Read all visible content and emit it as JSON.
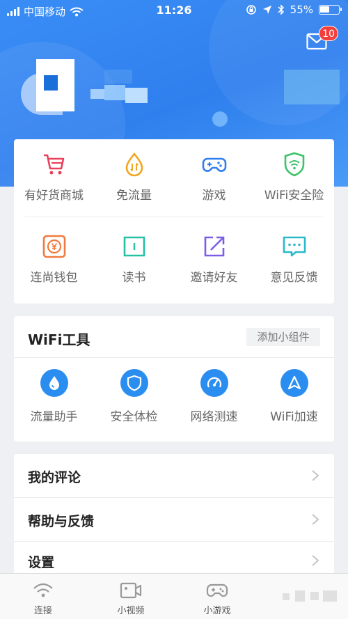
{
  "status_bar": {
    "carrier": "中国移动",
    "time": "11:26",
    "battery": "55%",
    "battery_level": 0.55
  },
  "header": {
    "mail_icon": "mail-icon",
    "unread_count": "10"
  },
  "grid": {
    "row1": [
      {
        "label": "有好货商城",
        "icon": "cart-icon",
        "color": "#e8415a"
      },
      {
        "label": "免流量",
        "icon": "free-data-icon",
        "color": "#f2a51e"
      },
      {
        "label": "游戏",
        "icon": "gamepad-icon",
        "color": "#2f7fee"
      },
      {
        "label": "WiFi安全险",
        "icon": "wifi-shield-icon",
        "color": "#3cc36a"
      }
    ],
    "row2": [
      {
        "label": "连尚钱包",
        "icon": "wallet-icon",
        "color": "#f07b3f"
      },
      {
        "label": "读书",
        "icon": "book-icon",
        "color": "#26c0a6"
      },
      {
        "label": "邀请好友",
        "icon": "invite-icon",
        "color": "#7d5ce8"
      },
      {
        "label": "意见反馈",
        "icon": "feedback-icon",
        "color": "#2bb9c9"
      }
    ]
  },
  "tools": {
    "title": "WiFi工具",
    "add_label": "添加小组件",
    "items": [
      {
        "label": "流量助手",
        "icon": "drop-icon"
      },
      {
        "label": "安全体检",
        "icon": "shield-icon"
      },
      {
        "label": "网络测速",
        "icon": "speedometer-icon"
      },
      {
        "label": "WiFi加速",
        "icon": "navigation-arrow-icon"
      }
    ],
    "accent": "#2a8df0"
  },
  "menu": {
    "items": [
      {
        "label": "我的评论"
      },
      {
        "label": "帮助与反馈"
      },
      {
        "label": "设置"
      }
    ]
  },
  "tab_bar": {
    "tabs": [
      {
        "label": "连接",
        "icon": "wifi-icon"
      },
      {
        "label": "小视频",
        "icon": "video-icon"
      },
      {
        "label": "小游戏",
        "icon": "gamepad-icon"
      }
    ]
  }
}
